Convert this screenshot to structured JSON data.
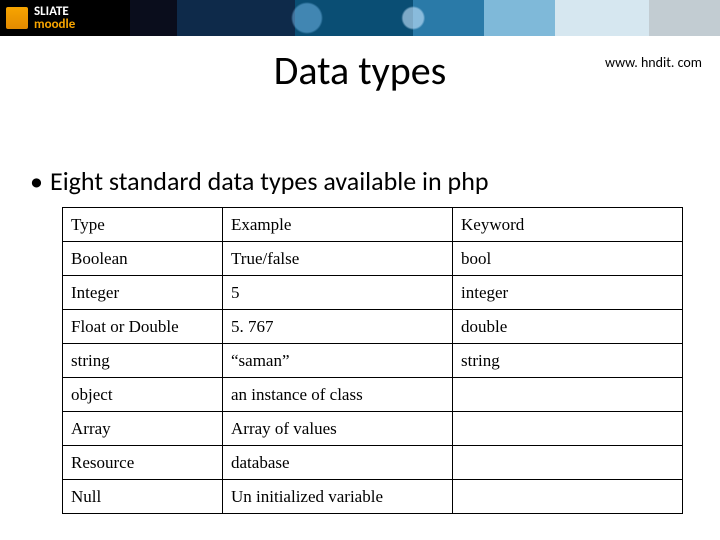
{
  "banner": {
    "logo_line1": "SLIATE",
    "logo_line2": "moodle"
  },
  "header": {
    "title": "Data types",
    "site_url": "www. hndit. com"
  },
  "bullet": "Eight standard data types available in php",
  "table": {
    "headers": [
      "Type",
      "Example",
      "Keyword"
    ],
    "rows": [
      {
        "type": "Boolean",
        "example": "True/false",
        "keyword": "bool"
      },
      {
        "type": "Integer",
        "example": "5",
        "keyword": "integer"
      },
      {
        "type": "Float or Double",
        "example": "5. 767",
        "keyword": "double"
      },
      {
        "type": "string",
        "example": "“saman”",
        "keyword": "string"
      },
      {
        "type": "object",
        "example": "an instance of class",
        "keyword": ""
      },
      {
        "type": "Array",
        "example": "Array of values",
        "keyword": ""
      },
      {
        "type": "Resource",
        "example": "database",
        "keyword": ""
      },
      {
        "type": "Null",
        "example": "Un initialized variable",
        "keyword": ""
      }
    ]
  }
}
